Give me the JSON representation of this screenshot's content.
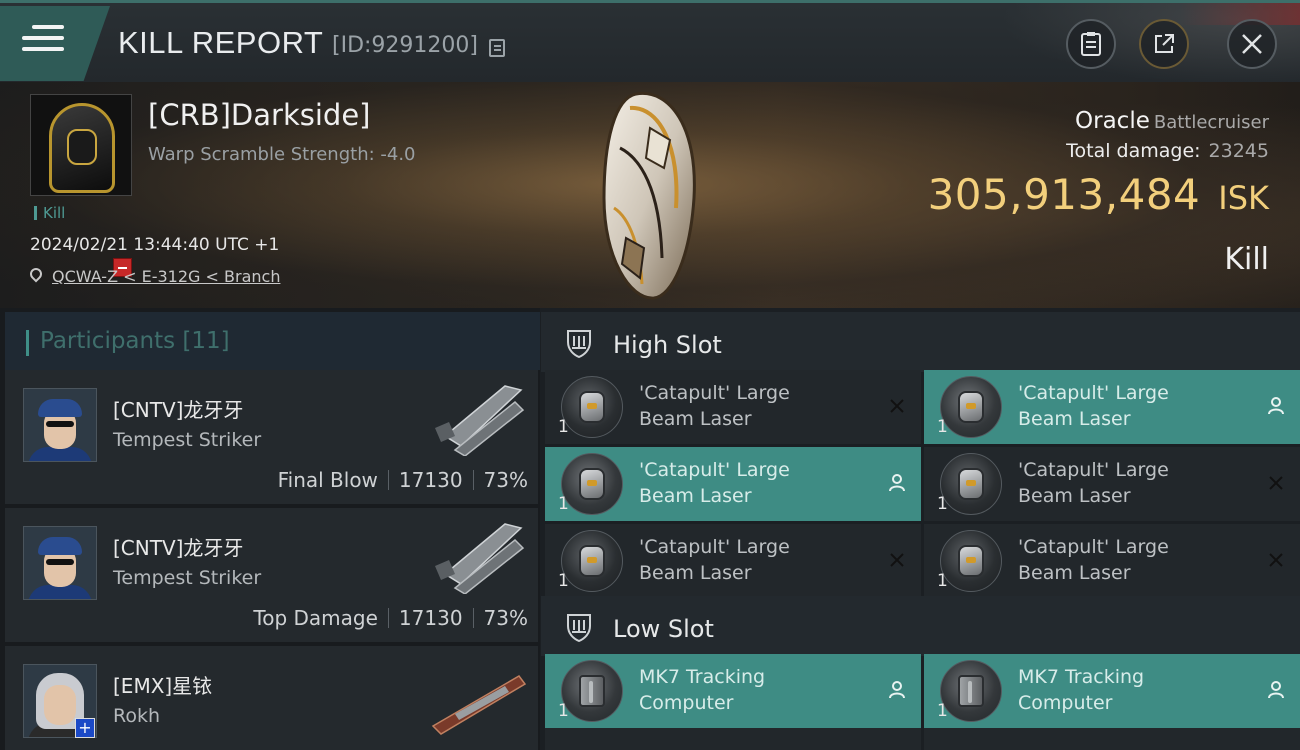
{
  "topbar": {
    "title": "KILL REPORT",
    "report_id": "[ID:9291200]"
  },
  "victim": {
    "name": "[CRB]Darkside]",
    "warp_scramble": "Warp Scramble Strength: -4.0",
    "tag": "Kill",
    "timestamp": "2024/02/21 13:44:40 UTC +1",
    "location": "QCWA-Z < E-312G < Branch",
    "ship_name": "Oracle",
    "ship_class": "Battlecruiser",
    "total_damage_label": "Total damage:",
    "total_damage_value": "23245",
    "isk_value": "305,913,484",
    "isk_unit": "ISK",
    "kill_type": "Kill"
  },
  "participants": {
    "title": "Participants",
    "count": "[11]",
    "items": [
      {
        "name": "[CNTV]龙牙牙",
        "ship": "Tempest Striker",
        "role": "Final Blow",
        "damage": "17130",
        "percent": "73%"
      },
      {
        "name": "[CNTV]龙牙牙",
        "ship": "Tempest Striker",
        "role": "Top Damage",
        "damage": "17130",
        "percent": "73%"
      },
      {
        "name": "[EMX]星铱",
        "ship": "Rokh"
      }
    ]
  },
  "fitting": {
    "high_slot": {
      "title": "High Slot",
      "modules": [
        {
          "line1": "'Catapult' Large",
          "line2": "Beam Laser",
          "qty": "1",
          "state": "destroyed"
        },
        {
          "line1": "'Catapult' Large",
          "line2": "Beam Laser",
          "qty": "1",
          "state": "dropped"
        },
        {
          "line1": "'Catapult' Large",
          "line2": "Beam Laser",
          "qty": "1",
          "state": "dropped"
        },
        {
          "line1": "'Catapult' Large",
          "line2": "Beam Laser",
          "qty": "1",
          "state": "destroyed"
        },
        {
          "line1": "'Catapult' Large",
          "line2": "Beam Laser",
          "qty": "1",
          "state": "destroyed"
        },
        {
          "line1": "'Catapult' Large",
          "line2": "Beam Laser",
          "qty": "1",
          "state": "destroyed"
        }
      ]
    },
    "low_slot": {
      "title": "Low Slot",
      "modules": [
        {
          "line1": "MK7 Tracking",
          "line2": "Computer",
          "qty": "1",
          "state": "dropped"
        },
        {
          "line1": "MK7 Tracking",
          "line2": "Computer",
          "qty": "1",
          "state": "dropped"
        }
      ]
    }
  },
  "colors": {
    "accent_teal": "#3e8c84",
    "isk_gold": "#f2cf7c",
    "status_red": "#c62828"
  },
  "icons": [
    "menu-icon",
    "copy-icon",
    "clipboard-icon",
    "share-icon",
    "close-icon",
    "location-pin-icon",
    "slot-shield-icon",
    "destroyed-x-icon",
    "dropped-person-icon"
  ]
}
